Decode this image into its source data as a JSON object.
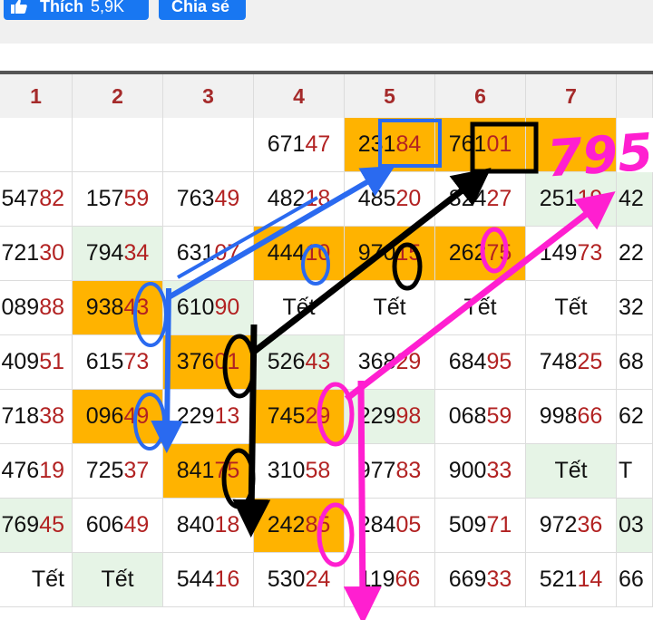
{
  "toolbar": {
    "like_label": "Thích",
    "like_count": "5,9K",
    "share_label": "Chia sẻ"
  },
  "headers": [
    "1",
    "2",
    "3",
    "4",
    "5",
    "6",
    "7"
  ],
  "rows": [
    [
      {
        "h": "",
        "t": ""
      },
      {
        "h": "",
        "t": ""
      },
      {
        "h": "",
        "t": ""
      },
      {
        "h": "671",
        "t": "47"
      },
      {
        "h": "231",
        "t": "84",
        "bg": "o"
      },
      {
        "h": "761",
        "t": "01",
        "bg": "o"
      },
      {
        "h": "",
        "t": "",
        "bg": "o"
      }
    ],
    [
      {
        "h": "547",
        "t": "82"
      },
      {
        "h": "157",
        "t": "59"
      },
      {
        "h": "763",
        "t": "49"
      },
      {
        "h": "482",
        "t": "18"
      },
      {
        "h": "485",
        "t": "20"
      },
      {
        "h": "824",
        "t": "27"
      },
      {
        "h": "251",
        "t": "19",
        "bg": "g"
      },
      {
        "h": "42",
        "t": "",
        "bg": "g"
      }
    ],
    [
      {
        "h": "721",
        "t": "30"
      },
      {
        "h": "794",
        "t": "34",
        "bg": "g"
      },
      {
        "h": "631",
        "t": "07"
      },
      {
        "h": "444",
        "t": "10",
        "bg": "o"
      },
      {
        "h": "970",
        "t": "15",
        "bg": "o"
      },
      {
        "h": "262",
        "t": "75",
        "bg": "o"
      },
      {
        "h": "149",
        "t": "73"
      },
      {
        "h": "22",
        "t": ""
      }
    ],
    [
      {
        "h": "089",
        "t": "88"
      },
      {
        "h": "938",
        "t": "43",
        "bg": "o"
      },
      {
        "h": "610",
        "t": "90",
        "bg": "g"
      },
      {
        "h": "Tết",
        "t": ""
      },
      {
        "h": "Tết",
        "t": ""
      },
      {
        "h": "Tết",
        "t": ""
      },
      {
        "h": "Tết",
        "t": ""
      },
      {
        "h": "32",
        "t": ""
      }
    ],
    [
      {
        "h": "409",
        "t": "51"
      },
      {
        "h": "615",
        "t": "73"
      },
      {
        "h": "376",
        "t": "01",
        "bg": "o"
      },
      {
        "h": "526",
        "t": "43",
        "bg": "g"
      },
      {
        "h": "368",
        "t": "29"
      },
      {
        "h": "684",
        "t": "95"
      },
      {
        "h": "748",
        "t": "25"
      },
      {
        "h": "68",
        "t": ""
      }
    ],
    [
      {
        "h": "718",
        "t": "38"
      },
      {
        "h": "096",
        "t": "49",
        "bg": "o"
      },
      {
        "h": "229",
        "t": "13"
      },
      {
        "h": "745",
        "t": "29",
        "bg": "o"
      },
      {
        "h": "229",
        "t": "98",
        "bg": "g"
      },
      {
        "h": "068",
        "t": "59"
      },
      {
        "h": "998",
        "t": "66"
      },
      {
        "h": "62",
        "t": ""
      }
    ],
    [
      {
        "h": "476",
        "t": "19"
      },
      {
        "h": "725",
        "t": "37"
      },
      {
        "h": "841",
        "t": "75",
        "bg": "o"
      },
      {
        "h": "310",
        "t": "58"
      },
      {
        "h": "977",
        "t": "83"
      },
      {
        "h": "900",
        "t": "33"
      },
      {
        "h": "Tết",
        "t": "",
        "bg": "g"
      },
      {
        "h": "T",
        "t": ""
      }
    ],
    [
      {
        "h": "769",
        "t": "45",
        "bg": "g"
      },
      {
        "h": "606",
        "t": "49"
      },
      {
        "h": "840",
        "t": "18"
      },
      {
        "h": "242",
        "t": "85",
        "bg": "o"
      },
      {
        "h": "284",
        "t": "05"
      },
      {
        "h": "509",
        "t": "71"
      },
      {
        "h": "972",
        "t": "36"
      },
      {
        "h": "03",
        "t": "",
        "bg": "g"
      }
    ],
    [
      {
        "h": "Tết",
        "t": ""
      },
      {
        "h": "Tết",
        "t": "",
        "bg": "g"
      },
      {
        "h": "544",
        "t": "16"
      },
      {
        "h": "530",
        "t": "24"
      },
      {
        "h": "119",
        "t": "66"
      },
      {
        "h": "669",
        "t": "33"
      },
      {
        "h": "521",
        "t": "14"
      },
      {
        "h": "66",
        "t": ""
      }
    ]
  ],
  "annotation": {
    "handwritten": "795",
    "colors": {
      "blue": "#2a6af0",
      "black": "#000000",
      "magenta": "#ff1fd0"
    }
  }
}
